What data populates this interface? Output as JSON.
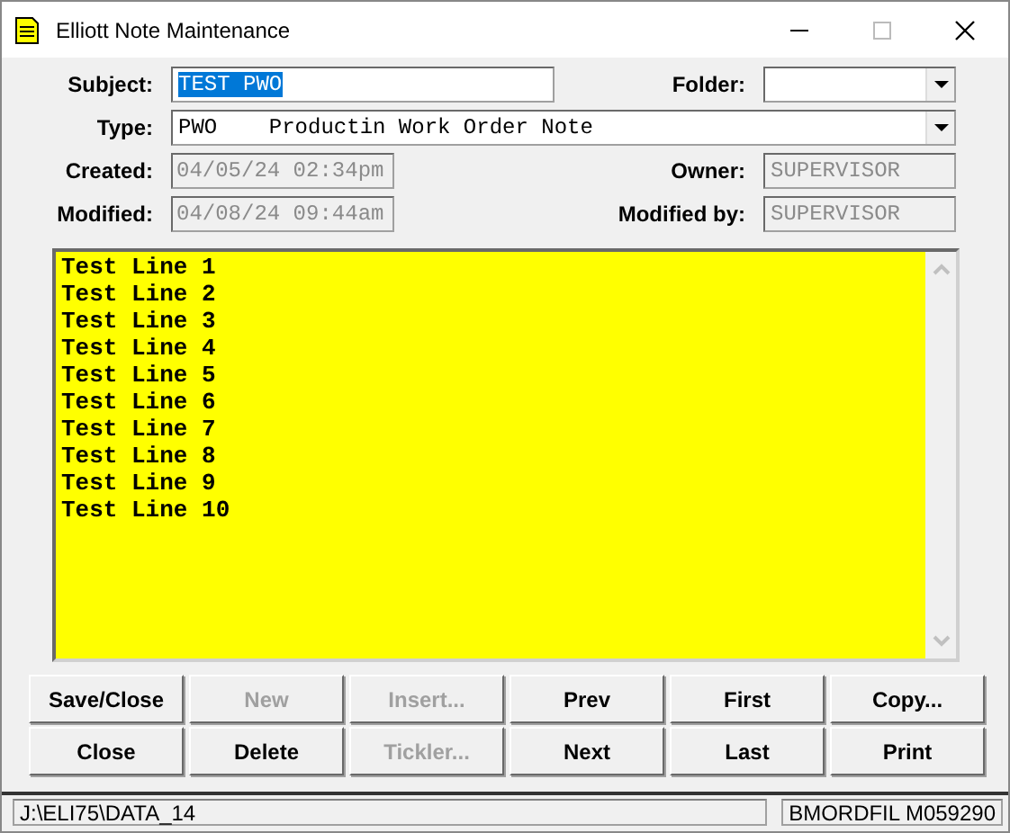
{
  "window": {
    "title": "Elliott Note Maintenance"
  },
  "fields": {
    "subject": {
      "label": "Subject:",
      "value": "TEST PWO",
      "text_selected": true
    },
    "folder": {
      "label": "Folder:"
    },
    "type": {
      "label": "Type:",
      "value": "PWO    Productin Work Order Note"
    },
    "created": {
      "label": "Created:",
      "value": "04/05/24 02:34pm"
    },
    "owner": {
      "label": "Owner:",
      "value": "SUPERVISOR"
    },
    "modified": {
      "label": "Modified:",
      "value": "04/08/24 09:44am"
    },
    "modified_by": {
      "label": "Modified by:",
      "value": "SUPERVISOR"
    }
  },
  "note_lines": [
    "Test Line 1",
    "Test Line 2",
    "Test Line 3",
    "Test Line 4",
    "Test Line 5",
    "Test Line 6",
    "Test Line 7",
    "Test Line 8",
    "Test Line 9",
    "Test Line 10"
  ],
  "buttons": [
    {
      "label": "Save/Close",
      "disabled": false
    },
    {
      "label": "New",
      "disabled": true
    },
    {
      "label": "Insert...",
      "disabled": true
    },
    {
      "label": "Prev",
      "disabled": false
    },
    {
      "label": "First",
      "disabled": false
    },
    {
      "label": "Copy...",
      "disabled": false
    },
    {
      "label": "Close",
      "disabled": false
    },
    {
      "label": "Delete",
      "disabled": false
    },
    {
      "label": "Tickler...",
      "disabled": true
    },
    {
      "label": "Next",
      "disabled": false
    },
    {
      "label": "Last",
      "disabled": false
    },
    {
      "label": "Print",
      "disabled": false
    }
  ],
  "status_bar": {
    "path": "J:\\ELI75\\DATA_14",
    "record": "BMORDFIL M059290"
  }
}
